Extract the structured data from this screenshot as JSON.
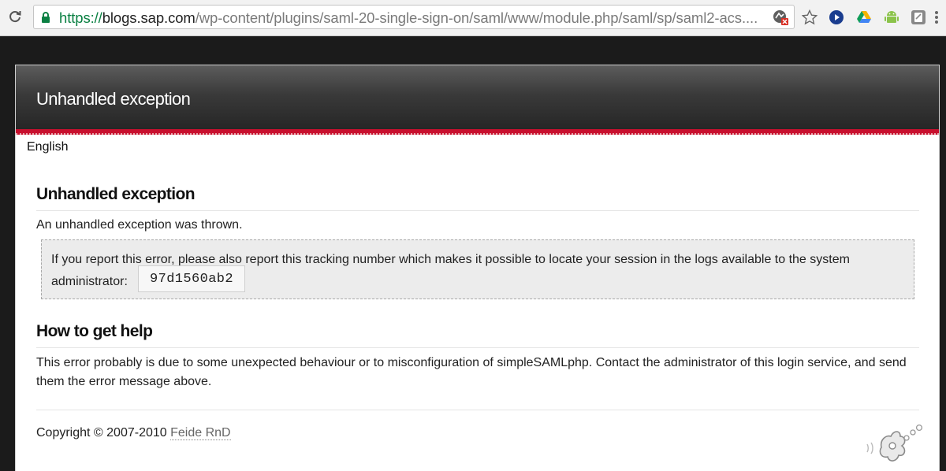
{
  "browser": {
    "url_scheme": "https://",
    "url_host": "blogs.sap.com",
    "url_path": "/wp-content/plugins/saml-20-single-sign-on/saml/www/module.php/saml/sp/saml2-acs....",
    "icons": [
      "reload-icon",
      "lock-icon",
      "extension-blocked-icon",
      "bookmark-star-icon",
      "play-extension-icon",
      "drive-icon",
      "android-icon",
      "app-extension-icon",
      "menu-icon"
    ]
  },
  "header": {
    "title": "Unhandled exception"
  },
  "language": "English",
  "error": {
    "heading": "Unhandled exception",
    "message": "An unhandled exception was thrown.",
    "tracking_text": "If you report this error, please also report this tracking number which makes it possible to locate your session in the logs available to the system administrator:",
    "tracking_number": "97d1560ab2"
  },
  "help": {
    "heading": "How to get help",
    "text": "This error probably is due to some unexpected behaviour or to misconfiguration of simpleSAMLphp. Contact the administrator of this login service, and send them the error message above."
  },
  "footer": {
    "copyright": "Copyright © 2007-2010",
    "link": "Feide RnD"
  },
  "colors": {
    "header_dark": "#262626",
    "accent_red": "#c8102e",
    "secure_green": "#0b8043"
  }
}
